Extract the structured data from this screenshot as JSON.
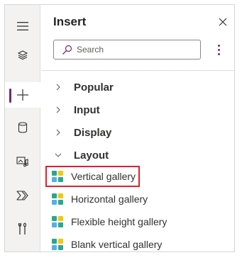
{
  "panel": {
    "title": "Insert",
    "close_icon": "close-icon",
    "more_icon": "more-vertical-icon"
  },
  "search": {
    "placeholder": "Search",
    "value": "",
    "icon": "search-icon"
  },
  "rail": {
    "items": [
      {
        "name": "menu",
        "icon": "hamburger-icon",
        "active": false
      },
      {
        "name": "tree-view",
        "icon": "layers-icon",
        "active": false
      },
      {
        "name": "insert",
        "icon": "plus-icon",
        "active": true
      },
      {
        "name": "data",
        "icon": "database-icon",
        "active": false
      },
      {
        "name": "media",
        "icon": "media-icon",
        "active": false
      },
      {
        "name": "power-automate",
        "icon": "power-automate-icon",
        "active": false
      },
      {
        "name": "advanced-tools",
        "icon": "tools-icon",
        "active": false
      }
    ]
  },
  "categories": [
    {
      "label": "Popular",
      "expanded": false
    },
    {
      "label": "Input",
      "expanded": false
    },
    {
      "label": "Display",
      "expanded": false
    },
    {
      "label": "Layout",
      "expanded": true
    }
  ],
  "layout_items": [
    {
      "label": "Vertical gallery",
      "icon": "gallery-icon",
      "selected": true
    },
    {
      "label": "Horizontal gallery",
      "icon": "gallery-icon",
      "selected": false
    },
    {
      "label": "Flexible height gallery",
      "icon": "gallery-icon",
      "selected": false
    },
    {
      "label": "Blank vertical gallery",
      "icon": "gallery-icon",
      "selected": false
    }
  ],
  "colors": {
    "accent": "#742774",
    "highlight_border": "#e0212f",
    "gallery_tl": "#2aa88d",
    "gallery_tr": "#f2c811",
    "gallery_bl": "#4fb3e8",
    "gallery_br": "#2aa88d"
  }
}
